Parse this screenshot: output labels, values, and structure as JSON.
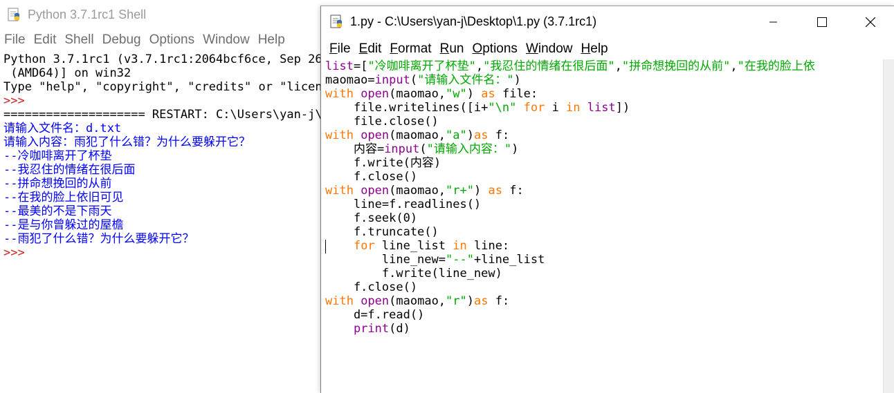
{
  "shell": {
    "title": "Python 3.7.1rc1 Shell",
    "menu": [
      "File",
      "Edit",
      "Shell",
      "Debug",
      "Options",
      "Window",
      "Help"
    ],
    "lines": [
      {
        "text": "Python 3.7.1rc1 (v3.7.1rc1:2064bcf6ce, Sep 26",
        "kind": "plain"
      },
      {
        "text": " (AMD64)] on win32",
        "kind": "plain"
      },
      {
        "text": "Type \"help\", \"copyright\", \"credits\" or \"licens",
        "kind": "plain"
      },
      {
        "text": ">>>",
        "kind": "prompt"
      },
      {
        "text": "==================== RESTART: C:\\Users\\yan-j\\D",
        "kind": "plain"
      },
      {
        "text": "请输入文件名：d.txt",
        "kind": "input"
      },
      {
        "text": "请输入内容：雨犯了什么错？为什么要躲开它？",
        "kind": "input"
      },
      {
        "text": "--冷咖啡离开了杯垫",
        "kind": "output"
      },
      {
        "text": "--我忍住的情绪在很后面",
        "kind": "output"
      },
      {
        "text": "--拼命想挽回的从前",
        "kind": "output"
      },
      {
        "text": "--在我的脸上依旧可见",
        "kind": "output"
      },
      {
        "text": "--最美的不是下雨天",
        "kind": "output"
      },
      {
        "text": "--是与你曾躲过的屋檐",
        "kind": "output"
      },
      {
        "text": "--雨犯了什么错？为什么要躲开它？",
        "kind": "output"
      },
      {
        "text": ">>>",
        "kind": "prompt"
      }
    ]
  },
  "editor": {
    "title": "1.py - C:\\Users\\yan-j\\Desktop\\1.py (3.7.1rc1)",
    "menu": [
      "File",
      "Edit",
      "Format",
      "Run",
      "Options",
      "Window",
      "Help"
    ],
    "code": [
      [
        {
          "t": "list",
          "c": "bi"
        },
        {
          "t": "=[",
          "c": ""
        },
        {
          "t": "\"冷咖啡离开了杯垫\"",
          "c": "st"
        },
        {
          "t": ",",
          "c": ""
        },
        {
          "t": "\"我忍住的情绪在很后面\"",
          "c": "st"
        },
        {
          "t": ",",
          "c": ""
        },
        {
          "t": "\"拼命想挽回的从前\"",
          "c": "st"
        },
        {
          "t": ",",
          "c": ""
        },
        {
          "t": "\"在我的脸上依",
          "c": "st"
        }
      ],
      [
        {
          "t": "maomao=",
          "c": ""
        },
        {
          "t": "input",
          "c": "bi"
        },
        {
          "t": "(",
          "c": ""
        },
        {
          "t": "\"请输入文件名：\"",
          "c": "st"
        },
        {
          "t": ")",
          "c": ""
        }
      ],
      [
        {
          "t": "with",
          "c": "kw"
        },
        {
          "t": " ",
          "c": ""
        },
        {
          "t": "open",
          "c": "bi"
        },
        {
          "t": "(maomao,",
          "c": ""
        },
        {
          "t": "\"w\"",
          "c": "st"
        },
        {
          "t": ") ",
          "c": ""
        },
        {
          "t": "as",
          "c": "kw"
        },
        {
          "t": " file:",
          "c": ""
        }
      ],
      [
        {
          "t": "    file.writelines([i+",
          "c": ""
        },
        {
          "t": "\"\\n\"",
          "c": "st"
        },
        {
          "t": " ",
          "c": ""
        },
        {
          "t": "for",
          "c": "kw"
        },
        {
          "t": " i ",
          "c": ""
        },
        {
          "t": "in",
          "c": "kw"
        },
        {
          "t": " ",
          "c": ""
        },
        {
          "t": "list",
          "c": "bi"
        },
        {
          "t": "])",
          "c": ""
        }
      ],
      [
        {
          "t": "    file.close()",
          "c": ""
        }
      ],
      [
        {
          "t": "with",
          "c": "kw"
        },
        {
          "t": " ",
          "c": ""
        },
        {
          "t": "open",
          "c": "bi"
        },
        {
          "t": "(maomao,",
          "c": ""
        },
        {
          "t": "\"a\"",
          "c": "st"
        },
        {
          "t": ")",
          "c": ""
        },
        {
          "t": "as",
          "c": "kw"
        },
        {
          "t": " f:",
          "c": ""
        }
      ],
      [
        {
          "t": "    内容=",
          "c": ""
        },
        {
          "t": "input",
          "c": "bi"
        },
        {
          "t": "(",
          "c": ""
        },
        {
          "t": "\"请输入内容：\"",
          "c": "st"
        },
        {
          "t": ")",
          "c": ""
        }
      ],
      [
        {
          "t": "    f.write(内容)",
          "c": ""
        }
      ],
      [
        {
          "t": "    f.close()",
          "c": ""
        }
      ],
      [
        {
          "t": "with",
          "c": "kw"
        },
        {
          "t": " ",
          "c": ""
        },
        {
          "t": "open",
          "c": "bi"
        },
        {
          "t": "(maomao,",
          "c": ""
        },
        {
          "t": "\"r+\"",
          "c": "st"
        },
        {
          "t": ") ",
          "c": ""
        },
        {
          "t": "as",
          "c": "kw"
        },
        {
          "t": " f:",
          "c": ""
        }
      ],
      [
        {
          "t": "    line=f.readlines()",
          "c": ""
        }
      ],
      [
        {
          "t": "    f.seek(0)",
          "c": ""
        }
      ],
      [
        {
          "t": "    f.truncate()",
          "c": ""
        }
      ],
      [
        {
          "t": "    ",
          "c": ""
        },
        {
          "t": "for",
          "c": "kw"
        },
        {
          "t": " line_list ",
          "c": ""
        },
        {
          "t": "in",
          "c": "kw"
        },
        {
          "t": " line:",
          "c": ""
        }
      ],
      [
        {
          "t": "        line_new=",
          "c": ""
        },
        {
          "t": "\"--\"",
          "c": "st"
        },
        {
          "t": "+line_list",
          "c": ""
        }
      ],
      [
        {
          "t": "        f.write(line_new)",
          "c": ""
        }
      ],
      [
        {
          "t": "    f.close()",
          "c": ""
        }
      ],
      [
        {
          "t": "with",
          "c": "kw"
        },
        {
          "t": " ",
          "c": ""
        },
        {
          "t": "open",
          "c": "bi"
        },
        {
          "t": "(maomao,",
          "c": ""
        },
        {
          "t": "\"r\"",
          "c": "st"
        },
        {
          "t": ")",
          "c": ""
        },
        {
          "t": "as",
          "c": "kw"
        },
        {
          "t": " f:",
          "c": ""
        }
      ],
      [
        {
          "t": "    d=f.read()",
          "c": ""
        }
      ],
      [
        {
          "t": "    ",
          "c": ""
        },
        {
          "t": "print",
          "c": "bi"
        },
        {
          "t": "(d)",
          "c": ""
        }
      ]
    ]
  },
  "colors": {
    "keyword": "#ff7700",
    "builtin": "#900090",
    "string": "#00aa00",
    "output": "#0000ff",
    "prompt": "#cc2222"
  }
}
